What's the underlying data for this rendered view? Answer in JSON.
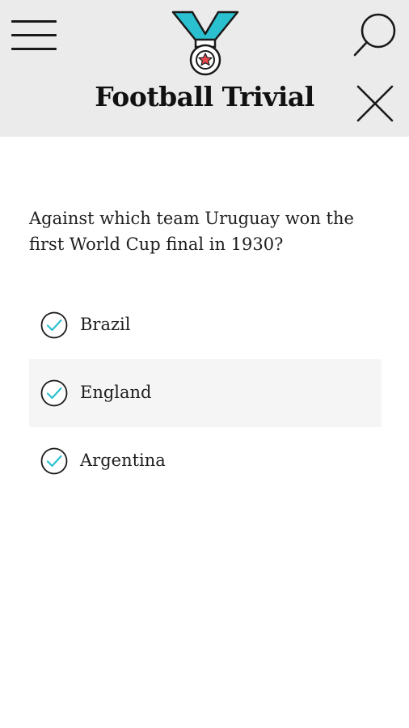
{
  "header": {
    "title": "Football Trivial",
    "menu_icon": "hamburger-menu-icon",
    "search_icon": "search-icon",
    "close_icon": "close-icon",
    "logo_icon": "medal-icon"
  },
  "colors": {
    "header_bg": "#ebebeb",
    "accent": "#2bc0cf",
    "star": "#e8474c",
    "highlight_row": "#f5f5f5"
  },
  "quiz": {
    "question": "Against which team Uruguay won the first World Cup final in 1930?",
    "answers": [
      {
        "label": "Brazil",
        "icon": "check-circle-icon"
      },
      {
        "label": "England",
        "icon": "check-circle-icon"
      },
      {
        "label": "Argentina",
        "icon": "check-circle-icon"
      }
    ]
  }
}
